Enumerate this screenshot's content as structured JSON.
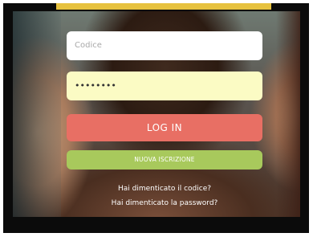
{
  "login": {
    "code_placeholder": "Codice",
    "password_value": "••••••••",
    "login_label": "LOG IN",
    "register_label": "NUOVA ISCRIZIONE",
    "forgot_code": "Hai dimenticato il codice?",
    "forgot_password": "Hai dimenticato la password?"
  },
  "colors": {
    "accent_bar": "#e7c23f",
    "login_button": "#e86f64",
    "register_button": "#a8c95c",
    "password_field": "#fbfbc4"
  }
}
